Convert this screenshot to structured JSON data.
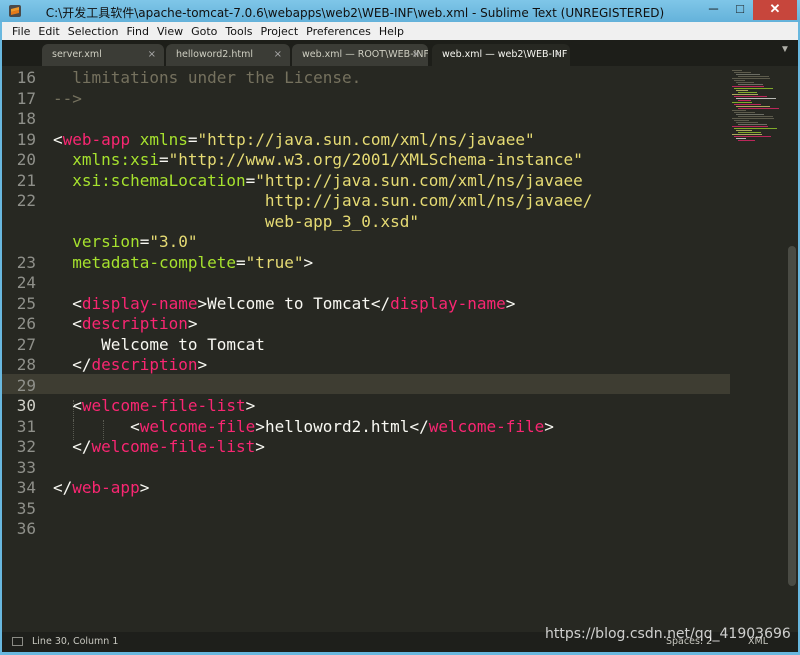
{
  "window": {
    "title": "C:\\开发工具软件\\apache-tomcat-7.0.6\\webapps\\web2\\WEB-INF\\web.xml - Sublime Text (UNREGISTERED)",
    "min_glyph": "─",
    "max_glyph": "□",
    "close_glyph": "✕"
  },
  "menu": [
    "File",
    "Edit",
    "Selection",
    "Find",
    "View",
    "Goto",
    "Tools",
    "Project",
    "Preferences",
    "Help"
  ],
  "tabs": [
    {
      "label": "server.xml",
      "active": false
    },
    {
      "label": "helloword2.html",
      "active": false
    },
    {
      "label": "web.xml — ROOT\\WEB-INF",
      "active": false
    },
    {
      "label": "web.xml — web2\\WEB-INF",
      "active": true
    }
  ],
  "tab_close_glyph": "×",
  "tab_dropdown_glyph": "▼",
  "editor": {
    "current_line": 30,
    "line_numbers": [
      "16",
      "17",
      "18",
      "19",
      "20",
      "21",
      "22",
      "",
      "",
      "23",
      "24",
      "25",
      "26",
      "27",
      "28",
      "29",
      "30",
      "31",
      "32",
      "33",
      "34",
      "35",
      "36"
    ],
    "lines": [
      [
        [
          "c",
          "  limitations under the License."
        ]
      ],
      [
        [
          "c",
          "-->"
        ]
      ],
      [],
      [
        [
          "p",
          "<"
        ],
        [
          "tag",
          "web-app"
        ],
        [
          "p",
          " "
        ],
        [
          "attr",
          "xmlns"
        ],
        [
          "p",
          "="
        ],
        [
          "str",
          "\"http://java.sun.com/xml/ns/javaee\""
        ]
      ],
      [
        [
          "p",
          "  "
        ],
        [
          "attr",
          "xmlns:xsi"
        ],
        [
          "p",
          "="
        ],
        [
          "str",
          "\"http://www.w3.org/2001/XMLSchema-instance\""
        ]
      ],
      [
        [
          "p",
          "  "
        ],
        [
          "attr",
          "xsi:schemaLocation"
        ],
        [
          "p",
          "="
        ],
        [
          "str",
          "\"http://java.sun.com/xml/ns/javaee"
        ]
      ],
      [
        [
          "p",
          "                      "
        ],
        [
          "str",
          "http://java.sun.com/xml/ns/javaee/"
        ]
      ],
      [
        [
          "p",
          "                      "
        ],
        [
          "str",
          "web-app_3_0.xsd\""
        ]
      ],
      [
        [
          "p",
          "  "
        ],
        [
          "attr",
          "version"
        ],
        [
          "p",
          "="
        ],
        [
          "str",
          "\"3.0\""
        ]
      ],
      [
        [
          "p",
          "  "
        ],
        [
          "attr",
          "metadata-complete"
        ],
        [
          "p",
          "="
        ],
        [
          "str",
          "\"true\""
        ],
        [
          "p",
          ">"
        ]
      ],
      [],
      [
        [
          "p",
          "  <"
        ],
        [
          "tag",
          "display-name"
        ],
        [
          "p",
          ">"
        ],
        [
          "txt",
          "Welcome to Tomcat"
        ],
        [
          "p",
          "</"
        ],
        [
          "tag",
          "display-name"
        ],
        [
          "p",
          ">"
        ]
      ],
      [
        [
          "p",
          "  <"
        ],
        [
          "tag",
          "description"
        ],
        [
          "p",
          ">"
        ]
      ],
      [
        [
          "p",
          "     "
        ],
        [
          "txt",
          "Welcome to Tomcat"
        ]
      ],
      [
        [
          "p",
          "  </"
        ],
        [
          "tag",
          "description"
        ],
        [
          "p",
          ">"
        ]
      ],
      [],
      [
        [
          "p",
          "  <"
        ],
        [
          "tag",
          "welcome-file-list"
        ],
        [
          "p",
          ">"
        ]
      ],
      [
        [
          "p",
          "        <"
        ],
        [
          "tag",
          "welcome-file"
        ],
        [
          "p",
          ">"
        ],
        [
          "txt",
          "helloword2.html"
        ],
        [
          "p",
          "</"
        ],
        [
          "tag",
          "welcome-file"
        ],
        [
          "p",
          ">"
        ]
      ],
      [
        [
          "p",
          "  </"
        ],
        [
          "tag",
          "welcome-file-list"
        ],
        [
          "p",
          ">"
        ]
      ],
      [],
      [
        [
          "p",
          "</"
        ],
        [
          "tag",
          "web-app"
        ],
        [
          "p",
          ">"
        ]
      ],
      []
    ]
  },
  "status": {
    "position": "Line 30, Column 1",
    "spaces": "Spaces: 2",
    "syntax": "XML"
  },
  "watermark": "https://blog.csdn.net/qq_41903696",
  "colors": {
    "background": "#272822",
    "comment": "#75715e",
    "tag": "#f92672",
    "attribute": "#a6e22e",
    "string": "#e6db74",
    "text": "#f8f8f2"
  }
}
